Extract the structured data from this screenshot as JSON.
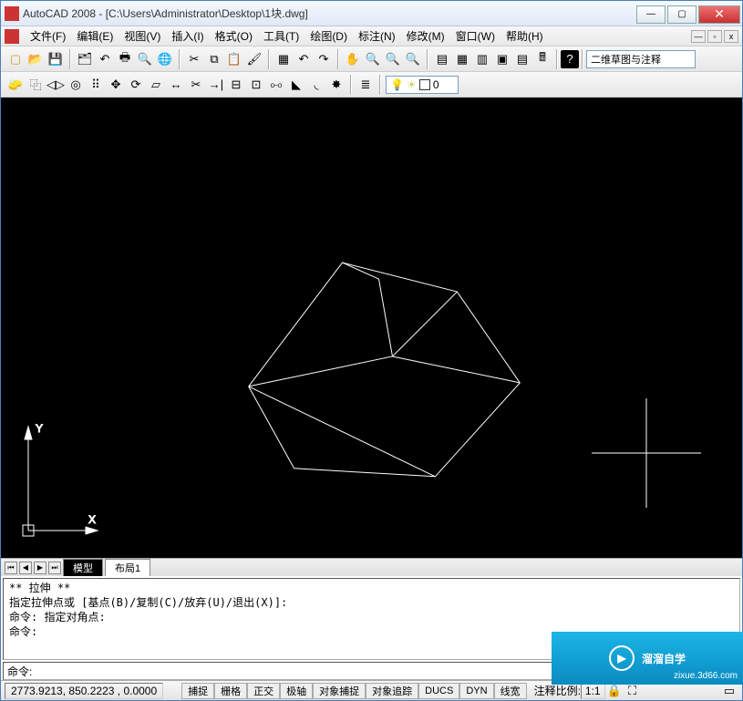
{
  "title": "AutoCAD 2008 - [C:\\Users\\Administrator\\Desktop\\1块.dwg]",
  "menus": {
    "file": "文件(F)",
    "edit": "编辑(E)",
    "view": "视图(V)",
    "insert": "插入(I)",
    "format": "格式(O)",
    "tools": "工具(T)",
    "draw": "绘图(D)",
    "dimension": "标注(N)",
    "modify": "修改(M)",
    "window": "窗口(W)",
    "help": "帮助(H)"
  },
  "workspace": "二维草图与注释",
  "layer_current": "0",
  "tabs": {
    "model": "模型",
    "layout1": "布局1"
  },
  "command_history": "** 拉伸 **\n指定拉伸点或 [基点(B)/复制(C)/放弃(U)/退出(X)]:\n命令: 指定对角点:\n命令:",
  "command_prompt": "命令:",
  "status": {
    "coords": "2773.9213, 850.2223 , 0.0000",
    "snap": "捕捉",
    "grid": "栅格",
    "ortho": "正交",
    "polar": "极轴",
    "osnap": "对象捕捉",
    "otrack": "对象追踪",
    "ducs": "DUCS",
    "dyn": "DYN",
    "lwt": "线宽",
    "ann_label": "注释比例:",
    "ann_scale": "1:1"
  },
  "ucs": {
    "y": "Y",
    "x": "X"
  },
  "watermark": {
    "text": "溜溜自学",
    "url": "zixue.3d66.com"
  }
}
